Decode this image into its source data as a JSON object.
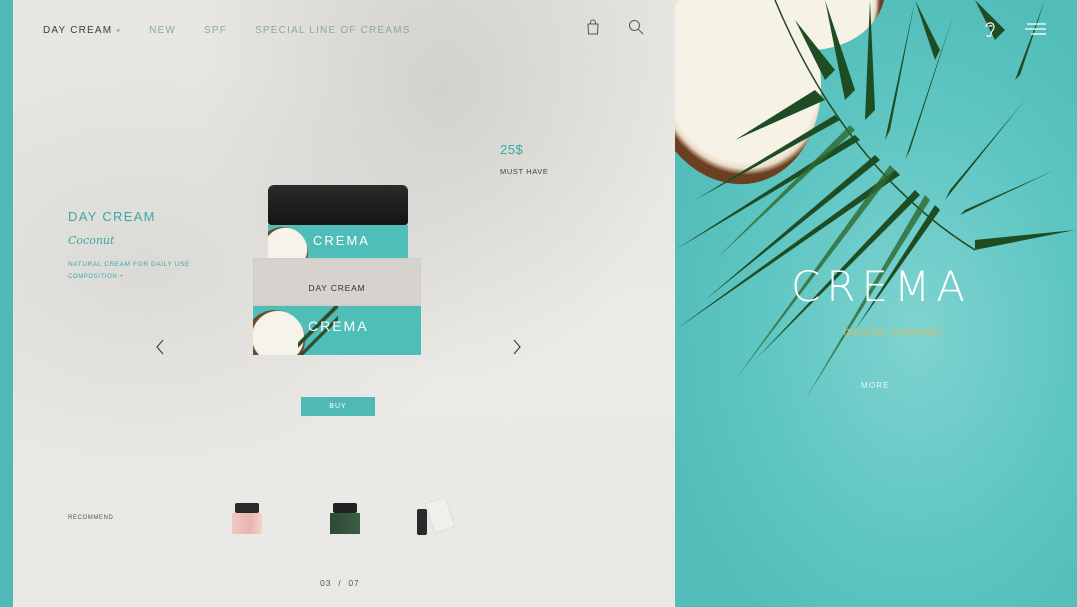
{
  "nav": {
    "items": [
      "DAY CREAM",
      "NEW",
      "SPF",
      "SPECIAL LINE OF CREAMS"
    ],
    "dropdown_caret": "▾"
  },
  "icons": {
    "bag": "shopping-bag-icon",
    "search": "search-icon",
    "ear": "ear-icon",
    "menu": "menu-icon",
    "arrow_left": "chevron-left-icon",
    "arrow_right": "chevron-right-icon"
  },
  "product": {
    "name": "DAY CREAM",
    "flavor": "Coconut",
    "description": "NATURAL CREAM FOR DAILY USE",
    "composition_link": "COMPOSITION +",
    "price": "25$",
    "price_tag": "MUST HAVE",
    "jar_logo": "CREMA",
    "box_label": "DAY CREAM",
    "box_logo": "CREMA",
    "buy_label": "BUY"
  },
  "recommend": {
    "label": "RECOMMEND"
  },
  "pager": {
    "current": "03",
    "separator": "/",
    "total": "07"
  },
  "hero": {
    "logo": "CREMA",
    "tagline": "natural cosmetic",
    "more_label": "MORE"
  },
  "colors": {
    "accent": "#4fb9b5",
    "tagline": "#e0b65a",
    "background": "#e9e8e4"
  }
}
